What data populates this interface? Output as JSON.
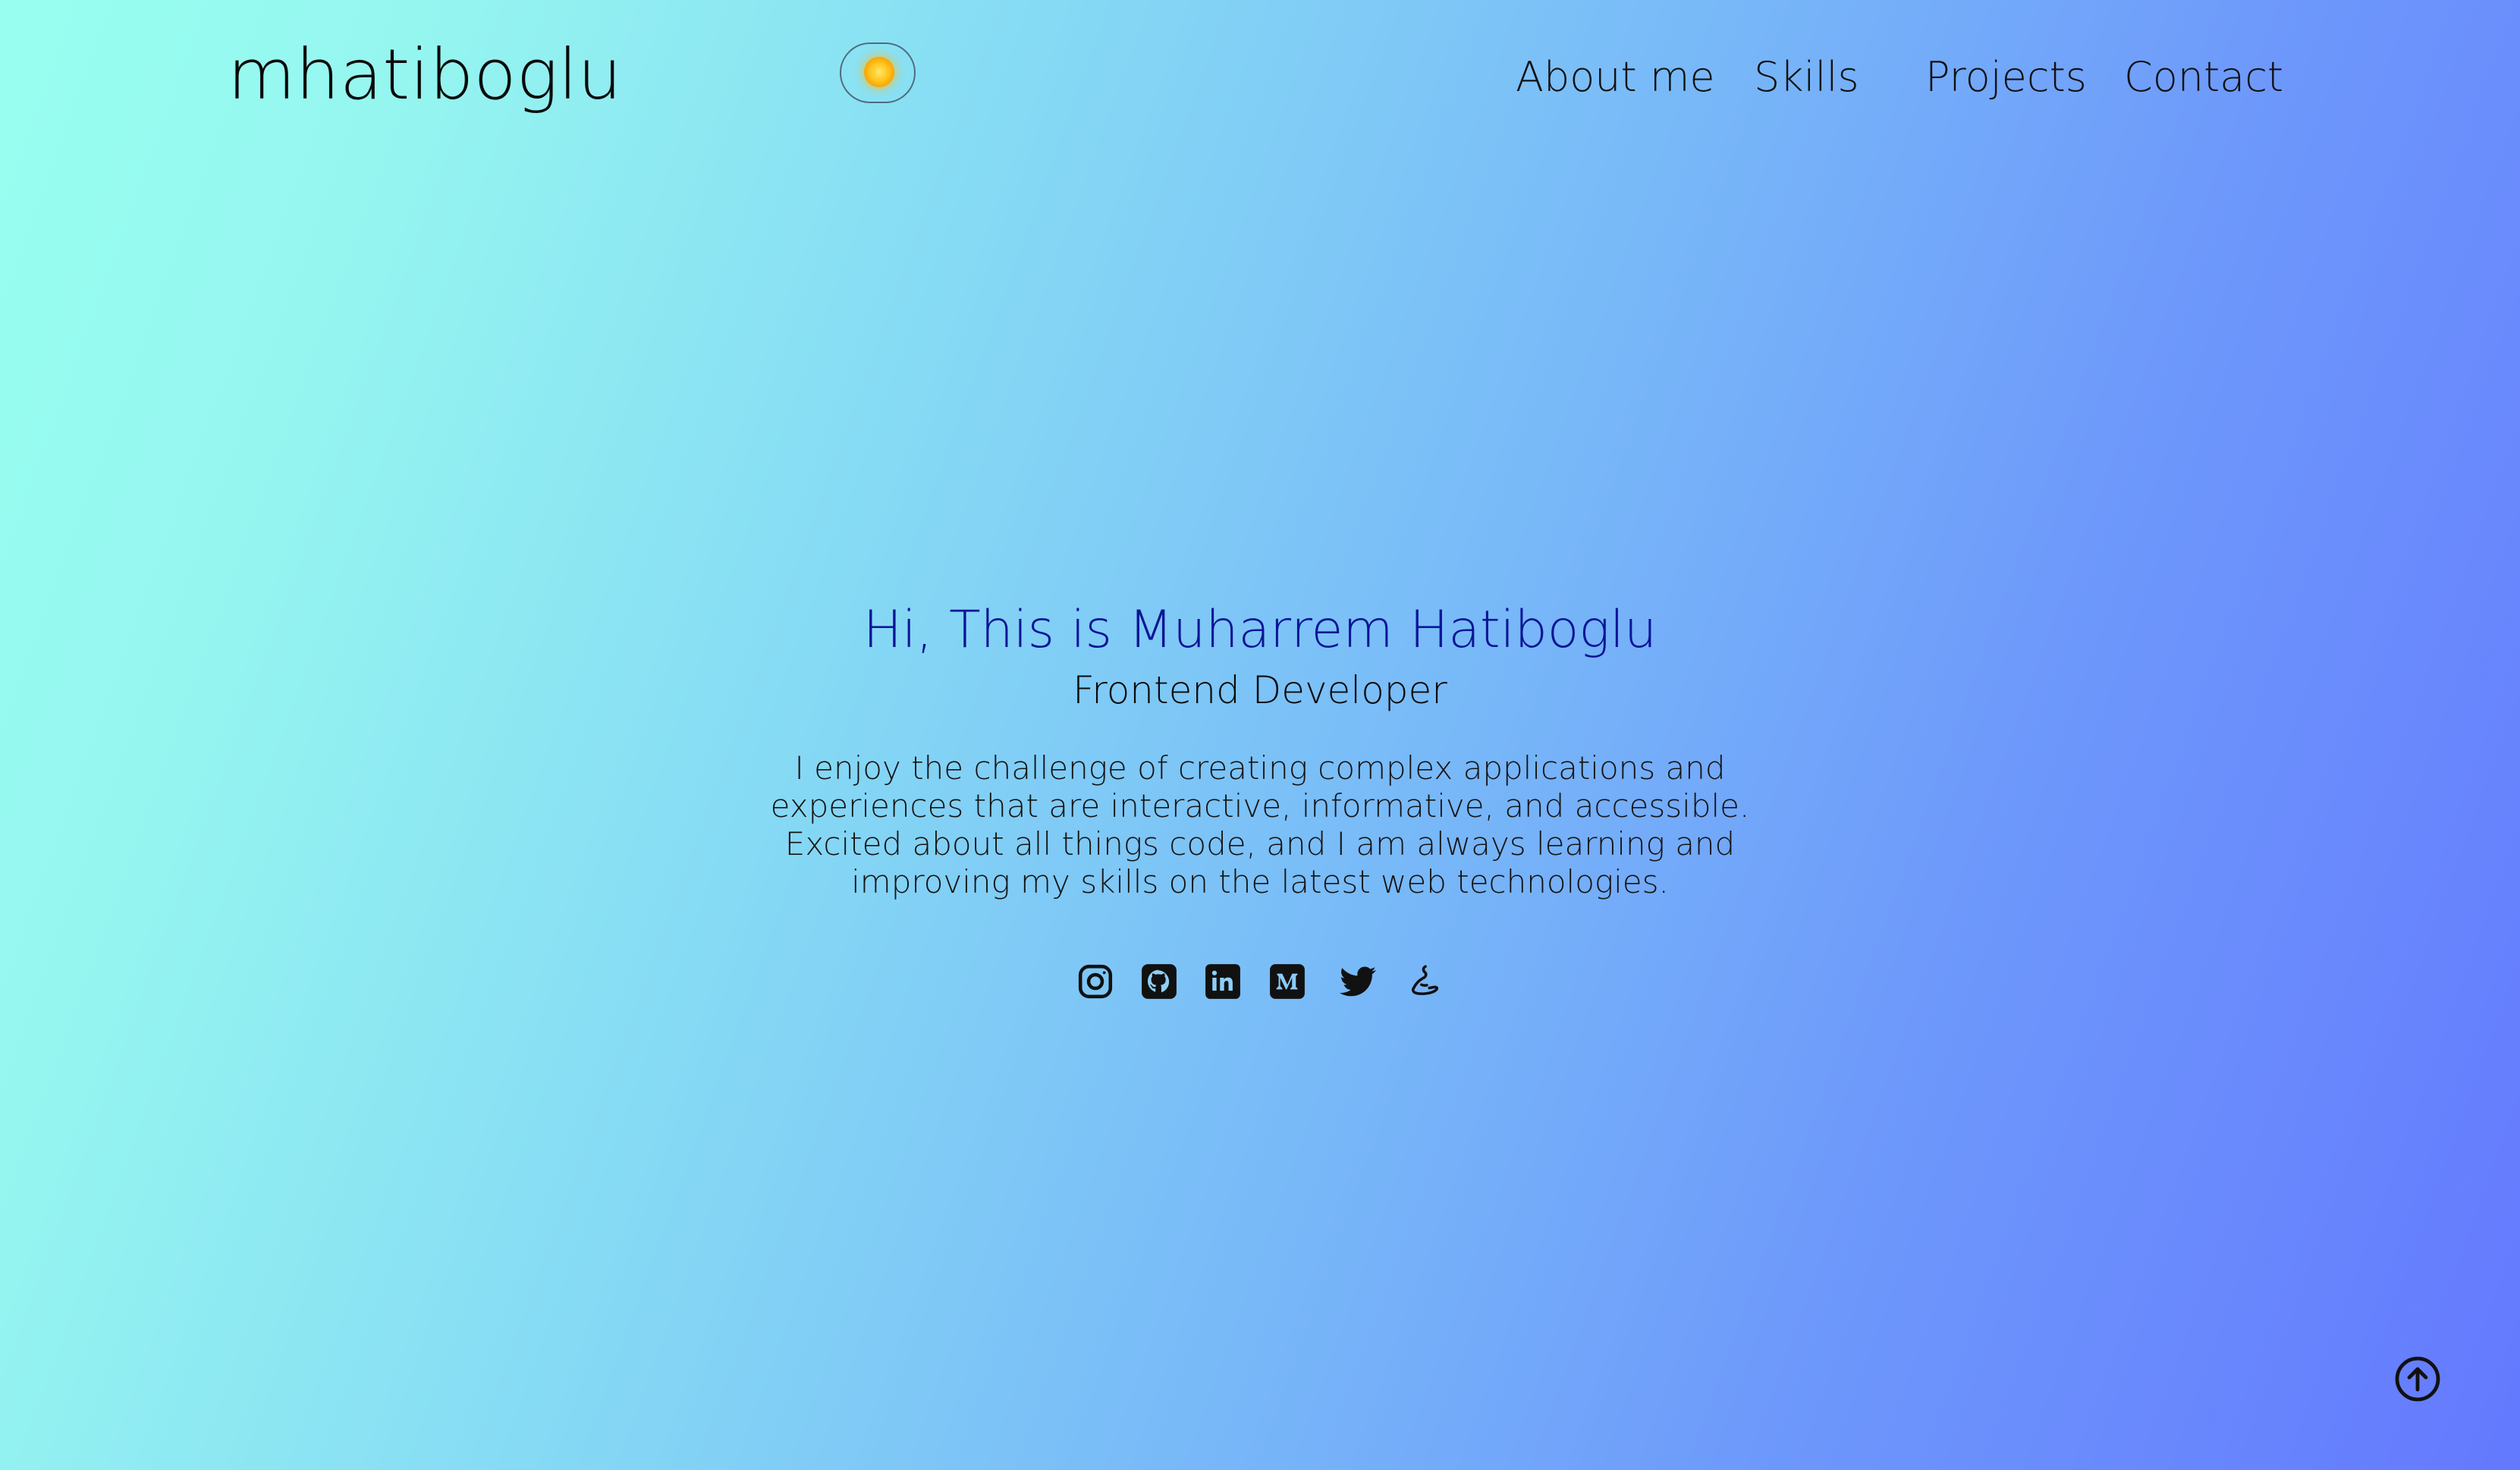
{
  "header": {
    "logo_text": "mhatiboglu",
    "theme_toggle_icon": "sun-icon"
  },
  "nav": {
    "items": [
      {
        "label": "About me"
      },
      {
        "label": "Skills"
      },
      {
        "label": "Projects"
      },
      {
        "label": "Contact"
      }
    ]
  },
  "hero": {
    "title": "Hi, This is Muharrem Hatiboglu",
    "subtitle": "Frontend Developer",
    "description": "I enjoy the challenge of creating complex applications and experiences that are interactive, informative, and accessible. Excited about all things code, and I am always learning and improving my skills on the latest web technologies."
  },
  "socials": [
    {
      "icon": "instagram-icon"
    },
    {
      "icon": "github-icon"
    },
    {
      "icon": "linkedin-icon"
    },
    {
      "icon": "medium-icon"
    },
    {
      "icon": "twitter-icon"
    },
    {
      "icon": "exercism-icon"
    }
  ],
  "scroll_top": {
    "icon": "arrow-up-circle-icon"
  },
  "colors": {
    "gradient_start": "#98fff0",
    "gradient_end": "#6479fe",
    "hero_title": "#0c1596",
    "text": "#111111",
    "sun": "#ffc21a"
  }
}
